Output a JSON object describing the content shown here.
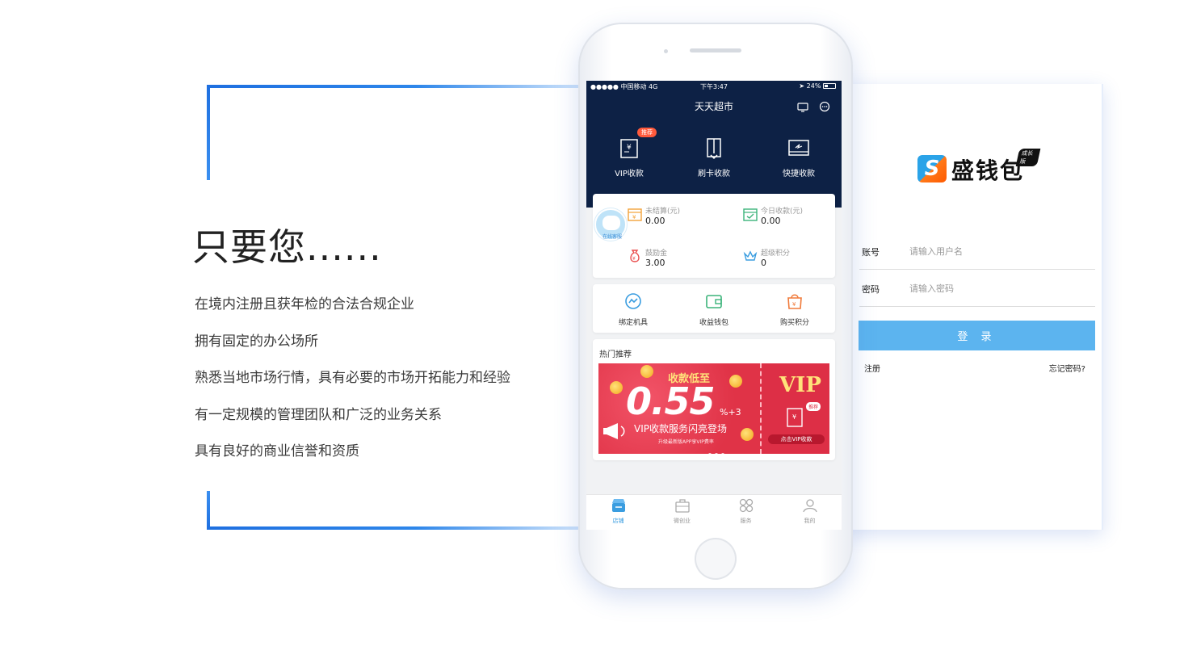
{
  "left": {
    "headline": "只要您......",
    "requirements": [
      "在境内注册且获年检的合法合规企业",
      "拥有固定的办公场所",
      "熟悉当地市场行情，具有必要的市场开拓能力和经验",
      "有一定规模的管理团队和广泛的业务关系",
      "具有良好的商业信誉和资质"
    ],
    "accent_color": "#1e6fe0"
  },
  "phone": {
    "status_bar": {
      "carrier": "●●●●● 中国移动  4G",
      "time": "下午3:47",
      "battery": "24%"
    },
    "title": "天天超市",
    "quick_actions": [
      {
        "label": "VIP收款",
        "badge": "推荐",
        "icon": "vip-receipt-icon"
      },
      {
        "label": "刷卡收款",
        "icon": "card-swipe-icon"
      },
      {
        "label": "快捷收款",
        "icon": "quick-pay-icon"
      }
    ],
    "avatar_caption": "在线客服",
    "stats": [
      {
        "name": "未结算(元)",
        "value": "0.00",
        "icon": "calendar-yen-icon"
      },
      {
        "name": "今日收款(元)",
        "value": "0.00",
        "icon": "calendar-check-icon"
      },
      {
        "name": "鼓励金",
        "value": "3.00",
        "icon": "money-bag-icon"
      },
      {
        "name": "超级积分",
        "value": "0",
        "icon": "crown-icon"
      }
    ],
    "tools": [
      {
        "label": "绑定机具",
        "icon": "link-icon"
      },
      {
        "label": "收益钱包",
        "icon": "wallet-icon"
      },
      {
        "label": "购买积分",
        "icon": "shopping-bag-icon"
      }
    ],
    "hot_title": "热门推荐",
    "banner": {
      "headline": "收款低至",
      "big": "0.55",
      "suffix": "%+3",
      "sub": "VIP收款服务闪亮登场",
      "small": "升级最新版APP享VIP费率",
      "vip": "VIP",
      "vip_tag": "推荐",
      "vip_btn": "点击VIP收款"
    },
    "tabs": [
      {
        "label": "店铺",
        "icon": "store-icon",
        "active": true
      },
      {
        "label": "微创业",
        "icon": "briefcase-icon",
        "active": false
      },
      {
        "label": "服务",
        "icon": "grid-icon",
        "active": false
      },
      {
        "label": "我的",
        "icon": "user-icon",
        "active": false
      }
    ]
  },
  "login": {
    "logo_mark": "S",
    "logo_text": "盛钱包",
    "logo_badge": "成长版",
    "username_label": "账号",
    "username_placeholder": "请输入用户名",
    "password_label": "密码",
    "password_placeholder": "请输入密码",
    "submit_label": "登 录",
    "register_label": "注册",
    "forgot_label": "忘记密码?",
    "button_color": "#5cb4ef"
  }
}
